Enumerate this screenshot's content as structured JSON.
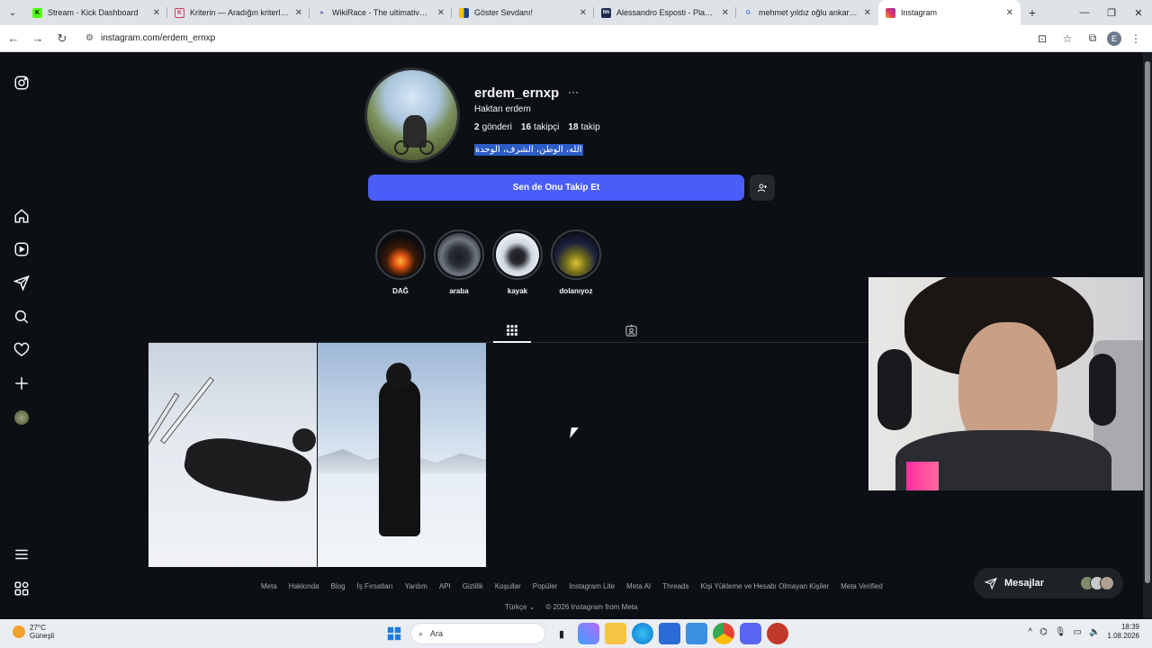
{
  "browser": {
    "tabs": [
      {
        "title": "Stream - Kick Dashboard",
        "fav_color": "#53fc18",
        "fav_glyph": "K"
      },
      {
        "title": "Kriterin — Aradığın kriterlere k",
        "fav_color": "#ffffff",
        "fav_glyph": "K"
      },
      {
        "title": "WikiRace - The ultimative Wiki",
        "fav_color": "#ffffff",
        "fav_glyph": "»"
      },
      {
        "title": "Göster Sevdanı!",
        "fav_color": "#f5c400",
        "fav_glyph": ""
      },
      {
        "title": "Alessandro Esposti - Player pro",
        "fav_color": "#1d2a4d",
        "fav_glyph": "tm"
      },
      {
        "title": "mehmet yıldız oğlu ankaragüc",
        "fav_color": "#ffffff",
        "fav_glyph": "G"
      },
      {
        "title": "Instagram",
        "fav_color": "#e1306c",
        "fav_glyph": "◎"
      }
    ],
    "url": "instagram.com/erdem_ernxp",
    "profile_initial": "E"
  },
  "profile": {
    "username": "erdem_ernxp",
    "full_name": "Haktan erdem",
    "posts_count": "2",
    "posts_label": "gönderi",
    "followers_count": "16",
    "followers_label": "takipçi",
    "following_count": "18",
    "following_label": "takip",
    "bio": "الله، الوطن، الشرف، الوحدة",
    "follow_button": "Sen de Onu Takip Et"
  },
  "highlights": [
    {
      "label": "DAĞ"
    },
    {
      "label": "araba"
    },
    {
      "label": "kayak"
    },
    {
      "label": "dolanıyoz"
    }
  ],
  "footer": {
    "links": [
      "Meta",
      "Hakkında",
      "Blog",
      "İş Fırsatları",
      "Yardım",
      "API",
      "Gizlilik",
      "Koşullar",
      "Popüler",
      "Instagram Lite",
      "Meta AI",
      "Threads",
      "Kişi Yükleme ve Hesabı Olmayan Kişiler",
      "Meta Verified"
    ],
    "language": "Türkçe",
    "copyright": "© 2026 Instagram from Meta"
  },
  "messages": {
    "label": "Mesajlar"
  },
  "taskbar": {
    "temperature": "27°C",
    "weather": "Güneşli",
    "search_placeholder": "Ara",
    "time": "18:39",
    "date": "1.08.2026"
  }
}
